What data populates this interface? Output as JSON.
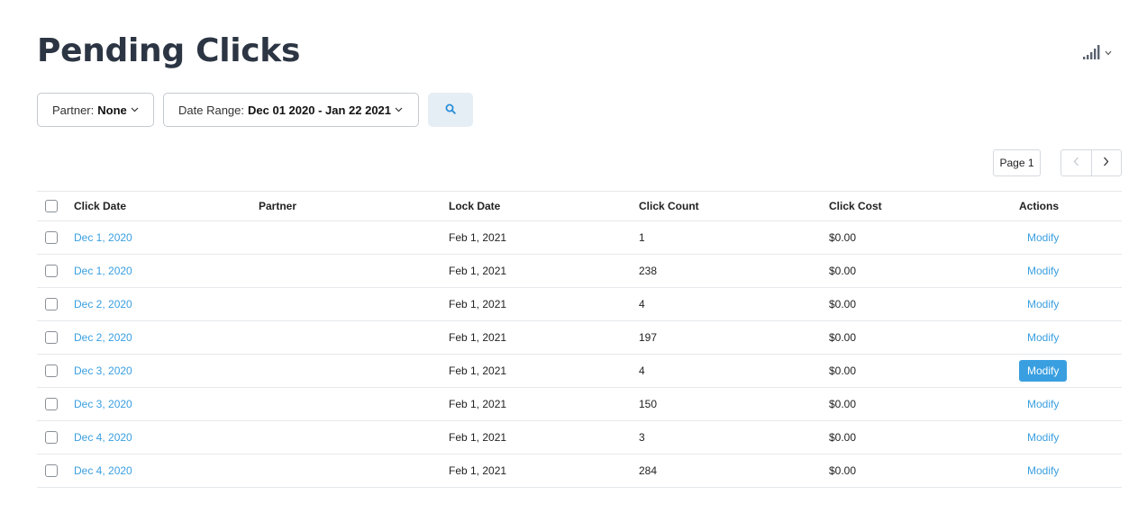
{
  "title": "Pending Clicks",
  "filters": {
    "partner_label": "Partner:",
    "partner_value": "None",
    "daterange_label": "Date Range:",
    "daterange_value": "Dec 01 2020 - Jan 22 2021"
  },
  "pagination": {
    "page_label": "Page 1"
  },
  "table": {
    "headers": {
      "click_date": "Click Date",
      "partner": "Partner",
      "lock_date": "Lock Date",
      "click_count": "Click Count",
      "click_cost": "Click Cost",
      "actions": "Actions"
    },
    "rows": [
      {
        "click_date": "Dec 1, 2020",
        "partner": "",
        "lock_date": "Feb 1, 2021",
        "click_count": "1",
        "click_cost": "$0.00",
        "action": "Modify"
      },
      {
        "click_date": "Dec 1, 2020",
        "partner": "",
        "lock_date": "Feb 1, 2021",
        "click_count": "238",
        "click_cost": "$0.00",
        "action": "Modify"
      },
      {
        "click_date": "Dec 2, 2020",
        "partner": "",
        "lock_date": "Feb 1, 2021",
        "click_count": "4",
        "click_cost": "$0.00",
        "action": "Modify"
      },
      {
        "click_date": "Dec 2, 2020",
        "partner": "",
        "lock_date": "Feb 1, 2021",
        "click_count": "197",
        "click_cost": "$0.00",
        "action": "Modify"
      },
      {
        "click_date": "Dec 3, 2020",
        "partner": "",
        "lock_date": "Feb 1, 2021",
        "click_count": "4",
        "click_cost": "$0.00",
        "action": "Modify"
      },
      {
        "click_date": "Dec 3, 2020",
        "partner": "",
        "lock_date": "Feb 1, 2021",
        "click_count": "150",
        "click_cost": "$0.00",
        "action": "Modify"
      },
      {
        "click_date": "Dec 4, 2020",
        "partner": "",
        "lock_date": "Feb 1, 2021",
        "click_count": "3",
        "click_cost": "$0.00",
        "action": "Modify"
      },
      {
        "click_date": "Dec 4, 2020",
        "partner": "",
        "lock_date": "Feb 1, 2021",
        "click_count": "284",
        "click_cost": "$0.00",
        "action": "Modify"
      }
    ]
  },
  "icons": {
    "signal": "signal-bars-icon",
    "search": "search-icon",
    "chevron_down": "chevron-down-icon",
    "prev": "chevron-left-icon",
    "next": "chevron-right-icon"
  },
  "colors": {
    "title": "#2c3543",
    "link": "#3a9fe0",
    "search_bg": "#e6eef5",
    "active_button": "#3a9fe0"
  }
}
